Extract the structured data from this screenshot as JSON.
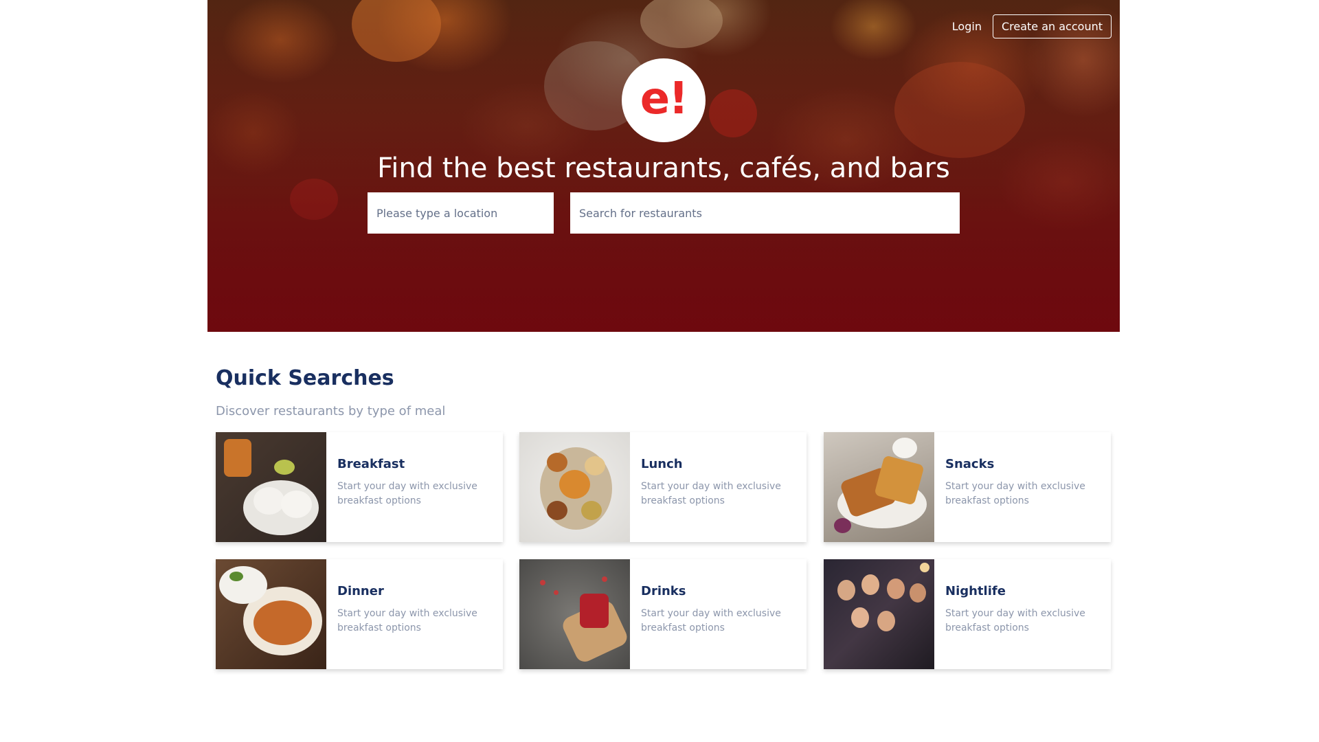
{
  "header": {
    "login_label": "Login",
    "create_account_label": "Create an account"
  },
  "hero": {
    "logo_text": "e!",
    "title": "Find the best restaurants, cafés, and bars",
    "location_placeholder": "Please type a location",
    "search_placeholder": "Search for restaurants"
  },
  "quick_searches": {
    "title": "Quick Searches",
    "subtitle": "Discover restaurants by type of meal",
    "cards": [
      {
        "title": "Breakfast",
        "description": "Start your day with exclusive breakfast options"
      },
      {
        "title": "Lunch",
        "description": "Start your day with exclusive breakfast options"
      },
      {
        "title": "Snacks",
        "description": "Start your day with exclusive breakfast options"
      },
      {
        "title": "Dinner",
        "description": "Start your day with exclusive breakfast options"
      },
      {
        "title": "Drinks",
        "description": "Start your day with exclusive breakfast options"
      },
      {
        "title": "Nightlife",
        "description": "Start your day with exclusive breakfast options"
      }
    ]
  },
  "colors": {
    "brand_red": "#eb2929",
    "heading_navy": "#192f60",
    "muted_text": "#8c96ab",
    "hero_bottom": "#6e0e12"
  }
}
